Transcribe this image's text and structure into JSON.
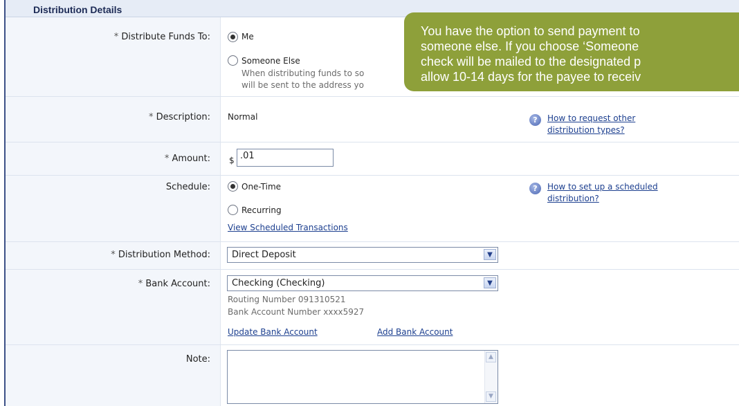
{
  "section": {
    "title": "Distribution Details"
  },
  "fields": {
    "distribute_to": {
      "label": "Distribute Funds To:",
      "req": "*",
      "options": [
        "Me",
        "Someone Else"
      ],
      "selected": "Me",
      "note_line1": "When distributing funds to so",
      "note_line2": "will be sent to the address yo"
    },
    "description": {
      "req": "*",
      "label": "Description:",
      "value": "Normal"
    },
    "amount": {
      "req": "*",
      "label": "Amount:",
      "currency": "$",
      "value": ".01"
    },
    "schedule": {
      "label": "Schedule:",
      "options": [
        "One-Time",
        "Recurring"
      ],
      "selected": "One-Time",
      "view_link": "View Scheduled Transactions"
    },
    "method": {
      "req": "*",
      "label": "Distribution Method:",
      "value": "Direct Deposit"
    },
    "bank": {
      "req": "*",
      "label": "Bank Account:",
      "value": "Checking (Checking)",
      "routing": "Routing Number 091310521",
      "account": "Bank Account Number xxxx5927",
      "update_link": "Update Bank Account",
      "add_link": "Add Bank Account"
    },
    "note": {
      "label": "Note:",
      "value": ""
    }
  },
  "help": {
    "other_types_line1": "How to request other",
    "other_types_line2": "distribution types?",
    "scheduled_line1": "How to set up a scheduled",
    "scheduled_line2": "distribution?"
  },
  "tooltip": {
    "lines": [
      "You have the option to send payment to",
      "someone else. If you choose ‘Someone",
      "check will be mailed to the designated p",
      "allow 10-14 days for the payee to receiv"
    ]
  },
  "colors": {
    "tooltip_bg": "#8ea03a",
    "link": "#1c3f8f",
    "header_bg": "#e6ecf6"
  }
}
